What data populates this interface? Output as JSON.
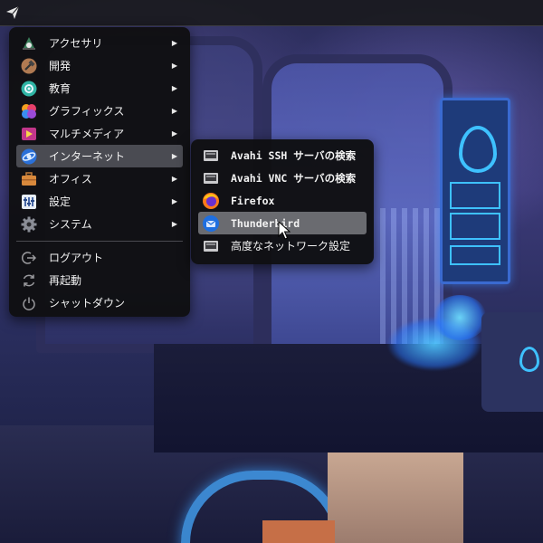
{
  "main_menu": {
    "items": [
      {
        "label": "アクセサリ",
        "icon": "accessories-icon",
        "submenu": true
      },
      {
        "label": "開発",
        "icon": "development-icon",
        "submenu": true
      },
      {
        "label": "教育",
        "icon": "education-icon",
        "submenu": true
      },
      {
        "label": "グラフィックス",
        "icon": "graphics-icon",
        "submenu": true
      },
      {
        "label": "マルチメディア",
        "icon": "multimedia-icon",
        "submenu": true
      },
      {
        "label": "インターネット",
        "icon": "internet-icon",
        "submenu": true,
        "active": true
      },
      {
        "label": "オフィス",
        "icon": "office-icon",
        "submenu": true
      },
      {
        "label": "設定",
        "icon": "settings-icon",
        "submenu": true
      },
      {
        "label": "システム",
        "icon": "system-icon",
        "submenu": true
      }
    ],
    "session": [
      {
        "label": "ログアウト",
        "icon": "logout-icon"
      },
      {
        "label": "再起動",
        "icon": "reboot-icon"
      },
      {
        "label": "シャットダウン",
        "icon": "shutdown-icon"
      }
    ],
    "arrow_glyph": "▶"
  },
  "internet_submenu": {
    "items": [
      {
        "label": "Avahi SSH サーバの検索",
        "icon": "network-icon"
      },
      {
        "label": "Avahi VNC サーバの検索",
        "icon": "network-icon"
      },
      {
        "label": "Firefox",
        "icon": "firefox-icon"
      },
      {
        "label": "Thunderbird",
        "icon": "thunderbird-icon",
        "active": true
      },
      {
        "label": "高度なネットワーク設定",
        "icon": "network-icon"
      }
    ]
  },
  "colors": {
    "menu_bg": "#101012",
    "active_bg": "#4a4b52",
    "text": "#f2f2f2"
  }
}
